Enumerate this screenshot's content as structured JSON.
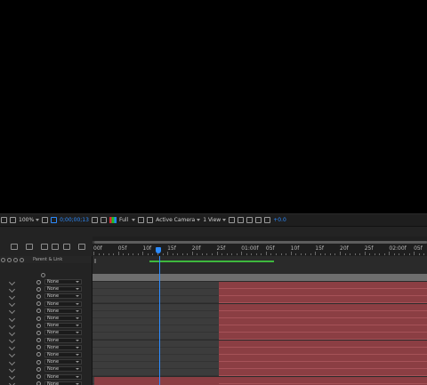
{
  "viewer_toolbar": {
    "zoom": "100%",
    "timecode": "0;00;00;13",
    "resolution": "Full",
    "camera": "Active Camera",
    "views": "1 View",
    "exposure": "+0.0"
  },
  "timeline": {
    "ruler_labels": [
      "00f",
      "05f",
      "10f",
      "15f",
      "20f",
      "25f",
      "01:00f",
      "05f",
      "10f",
      "15f",
      "20f",
      "25f",
      "02:00f",
      "05f"
    ],
    "column_header": "Parent & Link",
    "parent_option": "None",
    "layer_count": 16
  },
  "colors": {
    "accent": "#2d8cff",
    "layer_bar": "#8b3e43",
    "work_area": "#3eb83e",
    "panel_bg": "#232323"
  }
}
